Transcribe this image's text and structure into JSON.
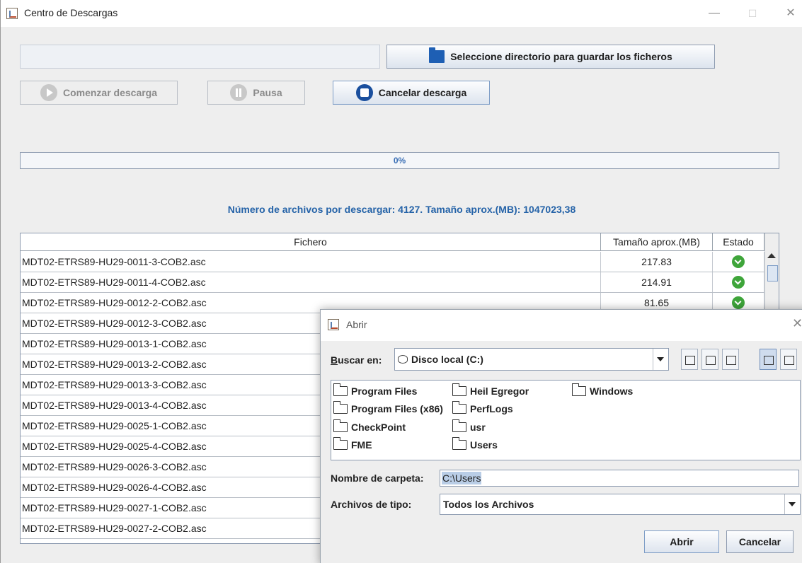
{
  "window": {
    "title": "Centro de Descargas",
    "controls": {
      "minimize": "—",
      "maximize": "☐",
      "close": "✕"
    }
  },
  "top": {
    "directory_value": "",
    "select_dir_button": "Seleccione directorio para guardar los ficheros",
    "start_button": "Comenzar descarga",
    "pause_button": "Pausa",
    "cancel_button": "Cancelar descarga"
  },
  "progress": {
    "text": "0%",
    "value": 0
  },
  "summary": "Número de archivos por descargar: 4127. Tamaño aprox.(MB): 1047023,38",
  "table": {
    "headers": [
      "Fichero",
      "Tamaño aprox.(MB)",
      "Estado"
    ],
    "rows": [
      {
        "file": "MDT02-ETRS89-HU29-0011-3-COB2.asc",
        "size": "217.83",
        "status_icon": "download-ok-icon"
      },
      {
        "file": "MDT02-ETRS89-HU29-0011-4-COB2.asc",
        "size": "214.91",
        "status_icon": "download-ok-icon"
      },
      {
        "file": "MDT02-ETRS89-HU29-0012-2-COB2.asc",
        "size": "81.65",
        "status_icon": "download-ok-icon"
      },
      {
        "file": "MDT02-ETRS89-HU29-0012-3-COB2.asc",
        "size": "",
        "status_icon": ""
      },
      {
        "file": "MDT02-ETRS89-HU29-0013-1-COB2.asc",
        "size": "",
        "status_icon": ""
      },
      {
        "file": "MDT02-ETRS89-HU29-0013-2-COB2.asc",
        "size": "",
        "status_icon": ""
      },
      {
        "file": "MDT02-ETRS89-HU29-0013-3-COB2.asc",
        "size": "",
        "status_icon": ""
      },
      {
        "file": "MDT02-ETRS89-HU29-0013-4-COB2.asc",
        "size": "",
        "status_icon": ""
      },
      {
        "file": "MDT02-ETRS89-HU29-0025-1-COB2.asc",
        "size": "",
        "status_icon": ""
      },
      {
        "file": "MDT02-ETRS89-HU29-0025-4-COB2.asc",
        "size": "",
        "status_icon": ""
      },
      {
        "file": "MDT02-ETRS89-HU29-0026-3-COB2.asc",
        "size": "",
        "status_icon": ""
      },
      {
        "file": "MDT02-ETRS89-HU29-0026-4-COB2.asc",
        "size": "",
        "status_icon": ""
      },
      {
        "file": "MDT02-ETRS89-HU29-0027-1-COB2.asc",
        "size": "",
        "status_icon": ""
      },
      {
        "file": "MDT02-ETRS89-HU29-0027-2-COB2.asc",
        "size": "",
        "status_icon": ""
      }
    ]
  },
  "dialog": {
    "title": "Abrir",
    "close": "✕",
    "look_in_label": "Buscar en:",
    "look_in_value": "Disco local (C:)",
    "toolbar_icons": [
      "up-folder-icon",
      "home-icon",
      "new-folder-icon",
      "list-view-icon",
      "details-view-icon"
    ],
    "folders": [
      "Program Files",
      "Program Files (x86)",
      "CheckPoint",
      "FME",
      "Heil Egregor",
      "PerfLogs",
      "usr",
      "Users",
      "Windows"
    ],
    "folder_name_label": "Nombre de carpeta:",
    "folder_name_value": "C:\\Users",
    "file_type_label": "Archivos de tipo:",
    "file_type_value": "Todos los Archivos",
    "open_button": "Abrir",
    "cancel_button": "Cancelar"
  },
  "colors": {
    "accent": "#2563a8",
    "ok": "#3ea53a",
    "stop": "#1a4f9e"
  }
}
